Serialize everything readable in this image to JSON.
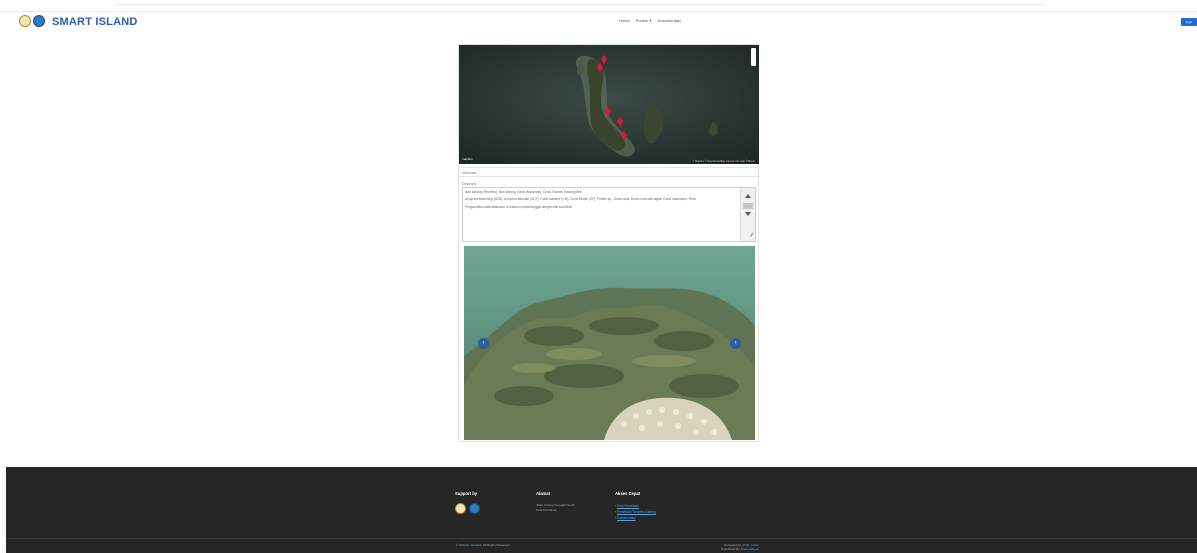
{
  "brand": {
    "name": "SMART ISLAND"
  },
  "nav": {
    "items": [
      "Home",
      "Produk ▾",
      "Dokumentasi"
    ],
    "login": "login"
  },
  "map": {
    "logo": "mapbox",
    "attribution": "© Mapbox © OpenStreetMap Improve this map © Maxar"
  },
  "info": {
    "header": "Informasi",
    "description_label": "Deskripsi",
    "description": [
      "Ikan karang (Terumbu), Ikan karang, Sand (Ancaman), Coral, Rubble, Karang Mati",
      "Acropora branching (ACB), Acropora tabulate (ACT), Coral massive (CM), Coral foliose (CF), Porites sp., Dead coral, Dead coral with algae, Coral mushroom, Rock",
      "Pengambilan data dilakukan di lokasi ini pada tanggal dengan titik koordinat"
    ]
  },
  "footer": {
    "support_title": "Support by",
    "address_title": "Alamat",
    "address_lines": [
      "Jalan Untung Suropati No.45",
      "Kota Pontianak"
    ],
    "quick_title": "Akses Cepat",
    "quick_links": [
      "Peta Pemetaan",
      "Pemetaan Terumbu Karang",
      "Dokumentasi"
    ],
    "copyright_prefix": "© ",
    "copyright_link": "Website Sekolah",
    "copyright_suffix": ". All Rights Reserved",
    "designed_prefix": "Designed by ",
    "designed_link": "HTML Codex",
    "distributed_prefix": "Distributed By ",
    "distributed_link": "ThemeWagon"
  }
}
